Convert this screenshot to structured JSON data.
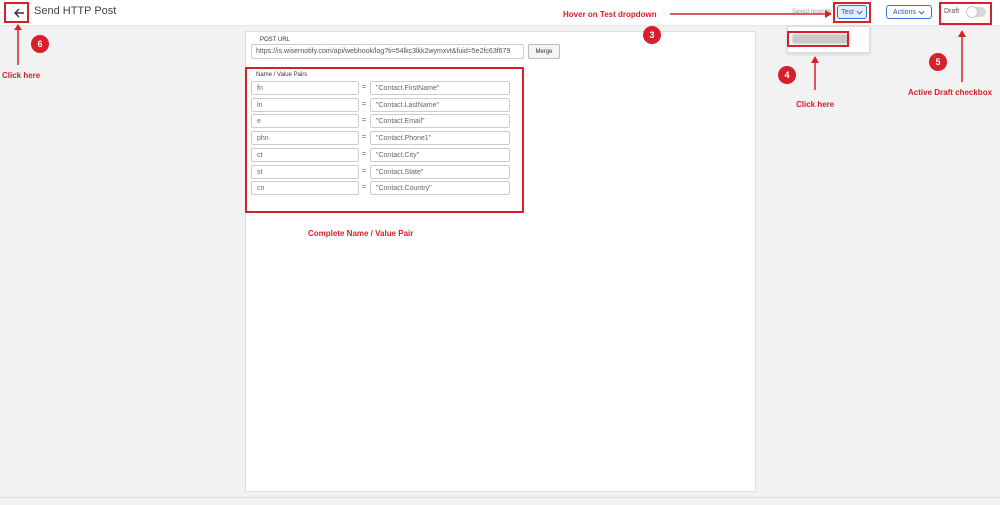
{
  "header": {
    "title": "Send HTTP Post",
    "saved_text": "Saved recently",
    "test_label": "Test",
    "actions_label": "Actions",
    "draft_label": "Draft",
    "draft_enabled": false
  },
  "form": {
    "post_url_label": "POST URL",
    "post_url_value": "https://is.wisernotify.com/api/webhook/log?ti=54lkc3lkk2wymxvt&fuid=5e2fc63f679",
    "merge_label": "Merge",
    "pairs_label": "Name / Value Pairs",
    "pairs": [
      {
        "name": "fn",
        "value": "\"Contact.FirstName\""
      },
      {
        "name": "ln",
        "value": "\"Contact.LastName\""
      },
      {
        "name": "e",
        "value": "\"Contact.Email\""
      },
      {
        "name": "phn",
        "value": "\"Contact.Phone1\""
      },
      {
        "name": "ct",
        "value": "\"Contact.City\""
      },
      {
        "name": "st",
        "value": "\"Contact.State\""
      },
      {
        "name": "cn",
        "value": "\"Contact.Country\""
      }
    ],
    "equals": "="
  },
  "annotations": {
    "step3": "3",
    "step3_text": "Hover on Test dropdown",
    "step4": "4",
    "step4_text": "Click here",
    "step5": "5",
    "step5_text": "Active Draft checkbox",
    "step6": "6",
    "step6_text": "Click here",
    "pairs_text": "Complete Name / Value Pair",
    "color": "#d6202a"
  },
  "icons": {
    "back": "arrow-left-icon",
    "chevron": "chevron-down-icon"
  }
}
